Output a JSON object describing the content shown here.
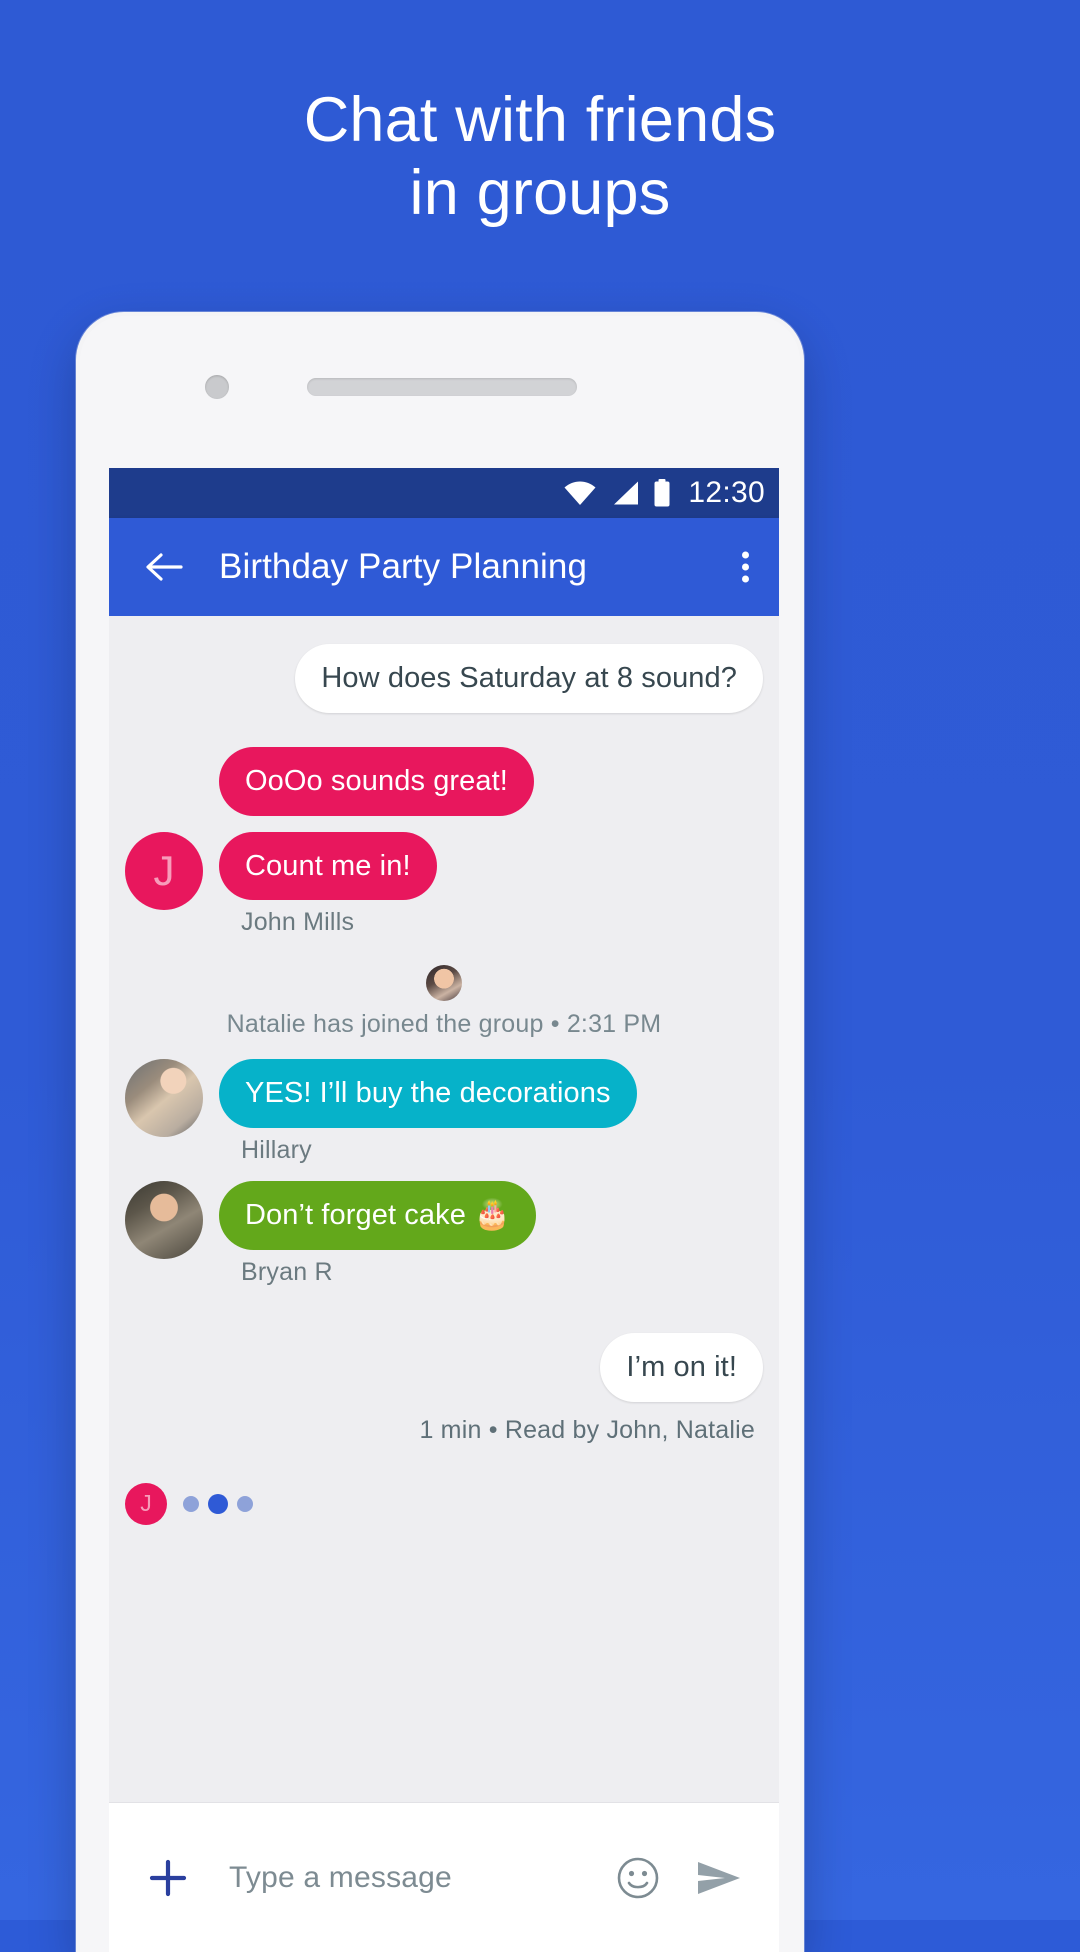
{
  "promo": {
    "headline_line1": "Chat with friends",
    "headline_line2": "in groups",
    "background_color": "#2f5bd6"
  },
  "phone": {
    "status_bar": {
      "time": "12:30",
      "background_color": "#1e3c8c",
      "icons": [
        "wifi-icon",
        "signal-icon",
        "battery-icon"
      ]
    },
    "app_bar": {
      "title": "Birthday Party Planning",
      "back_icon": "back-arrow-icon",
      "overflow_icon": "overflow-menu-icon",
      "background_color": "#2f5ad6"
    },
    "conversation": {
      "messages": [
        {
          "id": "m1",
          "side": "right",
          "text": "How does Saturday at 8 sound?",
          "bubble_color": "#ffffff",
          "text_color": "#37474f",
          "sender": "",
          "avatar": ""
        },
        {
          "id": "m2",
          "side": "left",
          "text": "OoOo sounds great!",
          "bubble_color": "#e8175d",
          "text_color": "#ffffff",
          "sender": "",
          "avatar": ""
        },
        {
          "id": "m3",
          "side": "left",
          "text": "Count me in!",
          "bubble_color": "#e8175d",
          "text_color": "#ffffff",
          "sender": "John Mills",
          "avatar": "J"
        },
        {
          "id": "m4",
          "side": "left",
          "text": "YES! I’ll buy the decorations",
          "bubble_color": "#06b2c9",
          "text_color": "#ffffff",
          "sender": "Hillary",
          "avatar": "photo-hillary"
        },
        {
          "id": "m5",
          "side": "left",
          "text": "Don’t forget cake 🎂",
          "bubble_color": "#63a81b",
          "text_color": "#ffffff",
          "sender": "Bryan R",
          "avatar": "photo-bryan"
        },
        {
          "id": "m6",
          "side": "right",
          "text": "I’m on it!",
          "bubble_color": "#ffffff",
          "text_color": "#37474f",
          "sender": "",
          "avatar": ""
        }
      ],
      "system_event": {
        "text": "Natalie has joined the group • 2:31 PM",
        "avatar": "photo-natalie"
      },
      "read_receipt": "1 min • Read by John, Natalie",
      "typing_indicator": {
        "avatar_letter": "J",
        "dot_count": 3,
        "active_dot_index": 1
      }
    },
    "input_bar": {
      "add_icon": "plus-icon",
      "placeholder": "Type a message",
      "value": "",
      "emoji_icon": "emoji-smiley-icon",
      "send_icon": "send-icon"
    }
  }
}
